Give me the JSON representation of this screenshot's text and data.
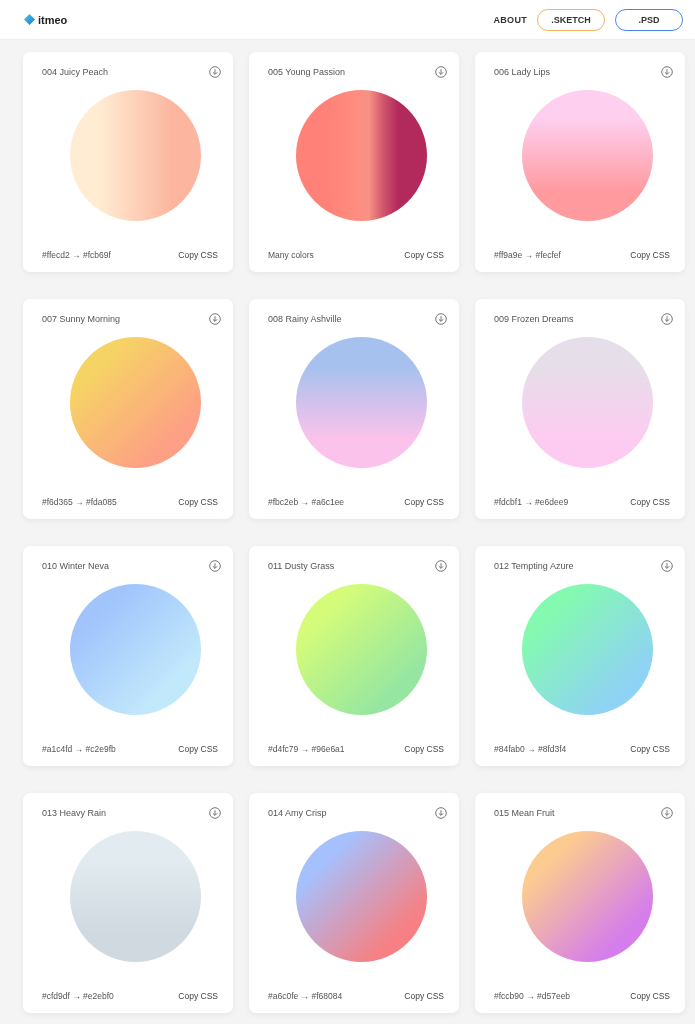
{
  "header": {
    "logo": "itmeo",
    "nav": [
      {
        "label": "ABOUT",
        "kind": "link"
      },
      {
        "label": ".SKETCH",
        "kind": "outline",
        "color": "#f5b35e"
      },
      {
        "label": ".PSD",
        "kind": "outline",
        "color": "#4a86e8"
      }
    ]
  },
  "cards": [
    {
      "title": "004 Juicy Peach",
      "caption": "#ffecd2 → #fcb69f",
      "action": "Copy CSS",
      "kind": "horizontal",
      "stops": [
        {
          "color": "#ffecd2"
        },
        {
          "color": "#fcb69f"
        }
      ]
    },
    {
      "title": "005 Young Passion",
      "caption": "Many colors",
      "action": "Copy CSS",
      "kind": "horizontal",
      "stops": [
        {
          "color": "#ff8177"
        },
        {
          "color": "#ff867a"
        },
        {
          "color": "#ff8c7f"
        },
        {
          "color": "#f99185"
        },
        {
          "color": "#cf556c"
        },
        {
          "color": "#b12a5b"
        }
      ]
    },
    {
      "title": "006 Lady Lips",
      "caption": "#ff9a9e → #fecfef",
      "action": "Copy CSS",
      "kind": "vertical",
      "stops": [
        {
          "color": "#fecfef"
        },
        {
          "color": "#ff9a9e"
        }
      ]
    },
    {
      "title": "007 Sunny Morning",
      "caption": "#f6d365 → #fda085",
      "action": "Copy CSS",
      "kind": "diagonal",
      "stops": [
        {
          "color": "#f6d365"
        },
        {
          "color": "#fda085"
        }
      ]
    },
    {
      "title": "008 Rainy Ashville",
      "caption": "#fbc2eb → #a6c1ee",
      "action": "Copy CSS",
      "kind": "vertical",
      "stops": [
        {
          "color": "#a6c1ee"
        },
        {
          "color": "#fbc2eb"
        }
      ]
    },
    {
      "title": "009 Frozen Dreams",
      "caption": "#fdcbf1 → #e6dee9",
      "action": "Copy CSS",
      "kind": "vertical",
      "stops": [
        {
          "color": "#e6dee9"
        },
        {
          "color": "#fdcbf1"
        }
      ]
    },
    {
      "title": "010 Winter Neva",
      "caption": "#a1c4fd → #c2e9fb",
      "action": "Copy CSS",
      "kind": "diagonal",
      "stops": [
        {
          "color": "#a1c4fd"
        },
        {
          "color": "#c2e9fb"
        }
      ]
    },
    {
      "title": "011 Dusty Grass",
      "caption": "#d4fc79 → #96e6a1",
      "action": "Copy CSS",
      "kind": "diagonal",
      "stops": [
        {
          "color": "#d4fc79"
        },
        {
          "color": "#96e6a1"
        }
      ]
    },
    {
      "title": "012 Tempting Azure",
      "caption": "#84fab0 → #8fd3f4",
      "action": "Copy CSS",
      "kind": "diagonal",
      "stops": [
        {
          "color": "#84fab0"
        },
        {
          "color": "#8fd3f4"
        }
      ]
    },
    {
      "title": "013 Heavy Rain",
      "caption": "#cfd9df → #e2ebf0",
      "action": "Copy CSS",
      "kind": "vertical",
      "stops": [
        {
          "color": "#e2ebf0"
        },
        {
          "color": "#cfd9df"
        }
      ]
    },
    {
      "title": "014 Amy Crisp",
      "caption": "#a6c0fe → #f68084",
      "action": "Copy CSS",
      "kind": "diagonal",
      "stops": [
        {
          "color": "#a6c0fe"
        },
        {
          "color": "#f68084"
        }
      ]
    },
    {
      "title": "015 Mean Fruit",
      "caption": "#fccb90 → #d57eeb",
      "action": "Copy CSS",
      "kind": "diagonal",
      "stops": [
        {
          "color": "#fccb90"
        },
        {
          "color": "#d57eeb"
        }
      ]
    }
  ]
}
